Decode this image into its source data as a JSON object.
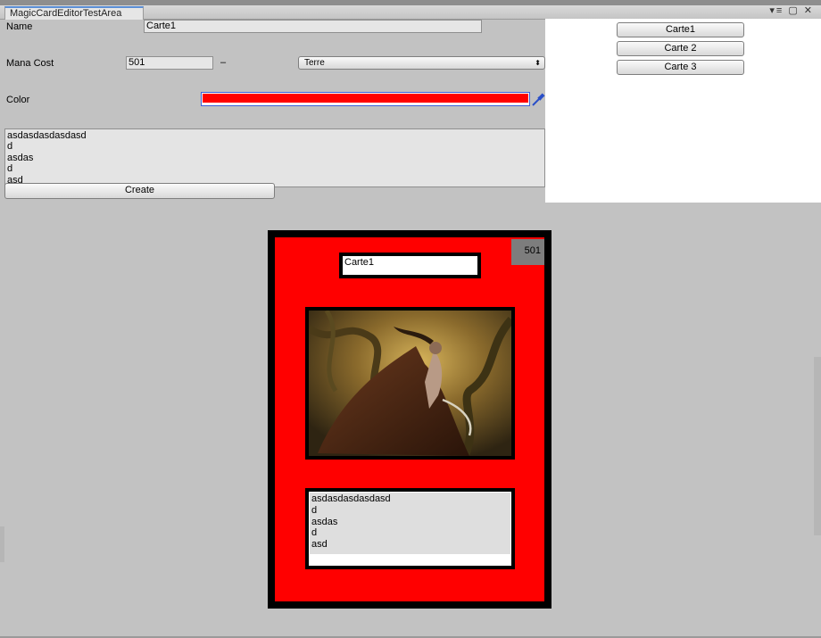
{
  "window": {
    "tab_title": "MagicCardEditorTestArea",
    "controls": "▾≡ ▢ ✕"
  },
  "form": {
    "name_label": "Name",
    "name_value": "Carte1",
    "mana_label": "Mana Cost",
    "mana_value": "501",
    "mana_separator": "–",
    "type_value": "Terre",
    "color_label": "Color",
    "color_value": "#ff0000",
    "description": "asdasdasdasdasd\nd\nasdas\nd\nasd",
    "create_label": "Create"
  },
  "card_list": [
    "Carte1",
    "Carte 2",
    "Carte 3"
  ],
  "card": {
    "name": "Carte1",
    "cost": "501",
    "text": "asdasdasdasdasd\nd\nasdas\nd\nasd",
    "face_color": "#ff0000"
  },
  "icons": {
    "eyedropper": "eyedropper-icon",
    "dropdown": "select-arrows-icon"
  }
}
